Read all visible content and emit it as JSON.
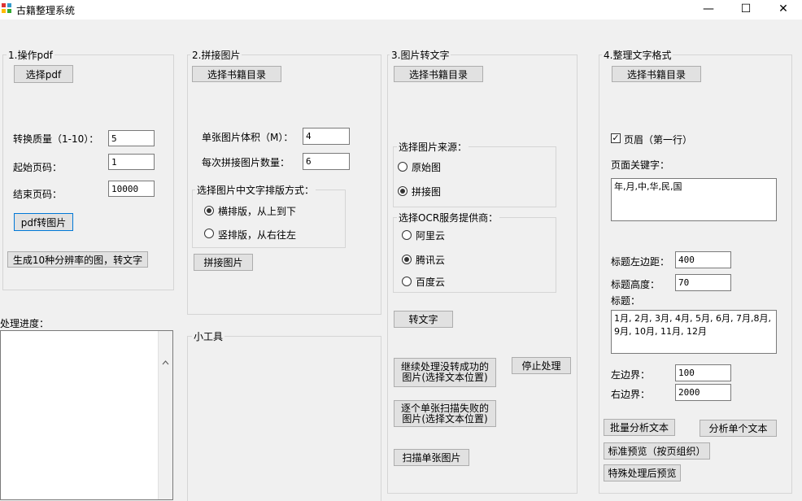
{
  "window": {
    "title": "古籍整理系统",
    "minimize": "—",
    "maximize": "☐",
    "close": "✕"
  },
  "section1": {
    "legend": "1.操作pdf",
    "select_pdf": "选择pdf",
    "quality_label": "转换质量（1-10）：",
    "quality_value": "5",
    "start_label": "起始页码：",
    "start_value": "1",
    "end_label": "结束页码：",
    "end_value": "10000",
    "pdf_to_img": "pdf转图片",
    "gen_button": "生成10种分辨率的图，转文字"
  },
  "progress": {
    "label": "处理进度："
  },
  "section2": {
    "legend": "2.拼接图片",
    "select_dir": "选择书籍目录",
    "size_label": "单张图片体积（M）：",
    "size_value": "4",
    "count_label": "每次拼接图片数量：",
    "count_value": "6",
    "layout_group": "选择图片中文字排版方式：",
    "horizontal": "横排版，从上到下",
    "vertical": "竖排版，从右往左",
    "merge_button": "拼接图片"
  },
  "tools": {
    "legend": "小工具"
  },
  "section3": {
    "legend": "3.图片转文字",
    "select_dir": "选择书籍目录",
    "source_group": "选择图片来源：",
    "source_original": "原始图",
    "source_merged": "拼接图",
    "ocr_group": "选择OCR服务提供商：",
    "ocr_aliyun": "阿里云",
    "ocr_tencent": "腾讯云",
    "ocr_baidu": "百度云",
    "convert": "转文字",
    "continue_line1": "继续处理没转成功的",
    "continue_line2": "图片(选择文本位置)",
    "stop": "停止处理",
    "rescan_line1": "逐个单张扫描失败的",
    "rescan_line2": "图片(选择文本位置)",
    "scan_single": "扫描单张图片"
  },
  "section4": {
    "legend": "4.整理文字格式",
    "select_dir": "选择书籍目录",
    "header_check": "页眉（第一行）",
    "keywords_label": "页面关键字：",
    "keywords_value": "年,月,中,华,民,国",
    "title_left_label": "标题左边距：",
    "title_left_value": "400",
    "title_height_label": "标题高度：",
    "title_height_value": "70",
    "title_label": "标题：",
    "title_value": "1月, 2月, 3月, 4月, 5月, 6月, 7月,8月, 9月, 10月, 11月, 12月",
    "left_label": "左边界：",
    "left_value": "100",
    "right_label": "右边界：",
    "right_value": "2000",
    "batch_analyze": "批量分析文本",
    "analyze_single": "分析单个文本",
    "std_preview": "标准预览（按页组织）",
    "special_preview": "特殊处理后预览"
  }
}
